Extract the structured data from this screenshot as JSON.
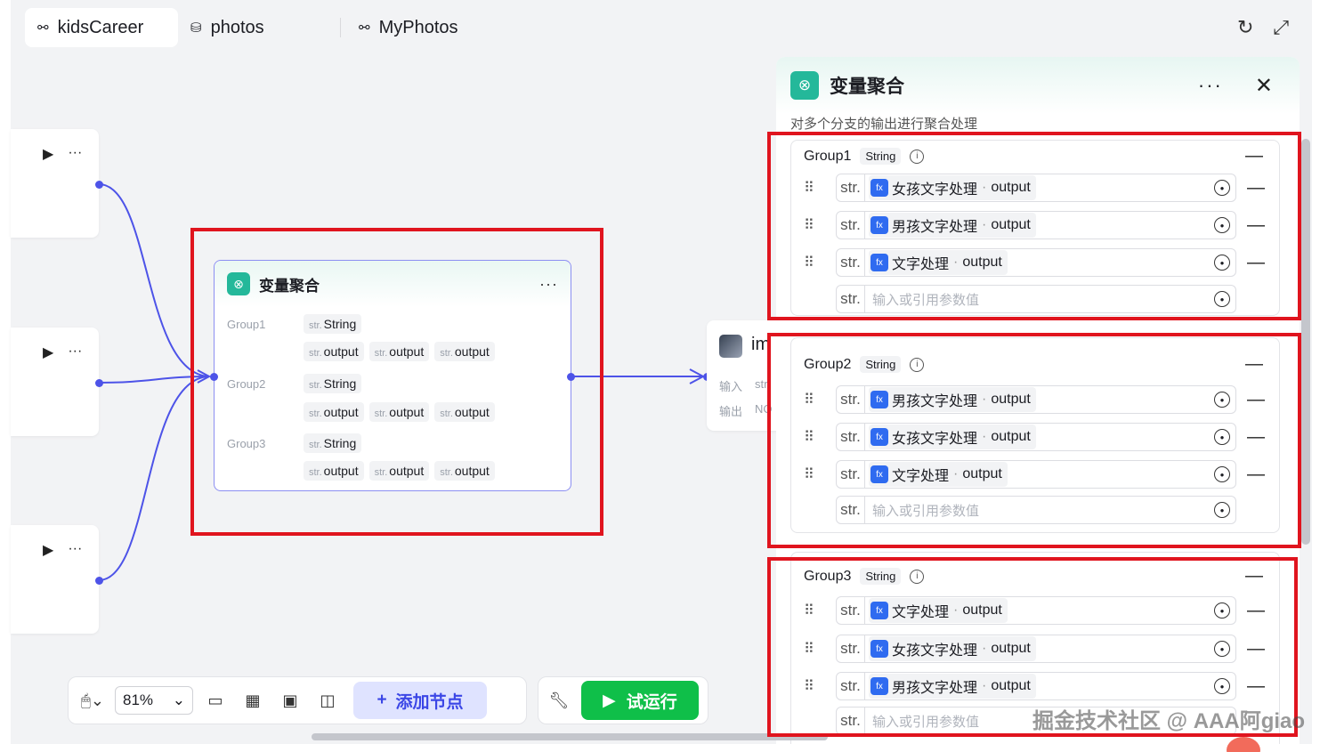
{
  "tabs": [
    {
      "label": "kidsCareer",
      "icon": "workflow-icon",
      "active": true
    },
    {
      "label": "photos",
      "icon": "database-icon",
      "active": false
    },
    {
      "label": "MyPhotos",
      "icon": "workflow-icon",
      "active": false
    }
  ],
  "node": {
    "title": "变量聚合",
    "groups": [
      {
        "name": "Group1",
        "type": "String",
        "type_prefix": "str.",
        "outputs": [
          "output",
          "output",
          "output"
        ]
      },
      {
        "name": "Group2",
        "type": "String",
        "type_prefix": "str.",
        "outputs": [
          "output",
          "output",
          "output"
        ]
      },
      {
        "name": "Group3",
        "type": "String",
        "type_prefix": "str.",
        "outputs": [
          "output",
          "output",
          "output"
        ]
      }
    ]
  },
  "img_node": {
    "name": "im",
    "in_label": "输入",
    "in_val": "str",
    "out_label": "输出",
    "out_val": "NO"
  },
  "panel": {
    "title": "变量聚合",
    "description": "对多个分支的输出进行聚合处理",
    "placeholder": "输入或引用参数值",
    "str": "str.",
    "groups": [
      {
        "name": "Group1",
        "type": "String",
        "vars": [
          {
            "node": "女孩文字处理",
            "field": "output"
          },
          {
            "node": "男孩文字处理",
            "field": "output"
          },
          {
            "node": "文字处理",
            "field": "output"
          }
        ]
      },
      {
        "name": "Group2",
        "type": "String",
        "vars": [
          {
            "node": "男孩文字处理",
            "field": "output"
          },
          {
            "node": "女孩文字处理",
            "field": "output"
          },
          {
            "node": "文字处理",
            "field": "output"
          }
        ]
      },
      {
        "name": "Group3",
        "type": "String",
        "vars": [
          {
            "node": "文字处理",
            "field": "output"
          },
          {
            "node": "女孩文字处理",
            "field": "output"
          },
          {
            "node": "男孩文字处理",
            "field": "output"
          }
        ]
      }
    ]
  },
  "toolbar": {
    "zoom": "81%",
    "add_node": "添加节点",
    "run": "试运行"
  },
  "watermark": "掘金技术社区 @ AAA阿giao",
  "colors": {
    "accent": "#4d53e8",
    "highlight": "#e0141e",
    "run": "#0fbf49",
    "node_icon": "#24b89a"
  }
}
